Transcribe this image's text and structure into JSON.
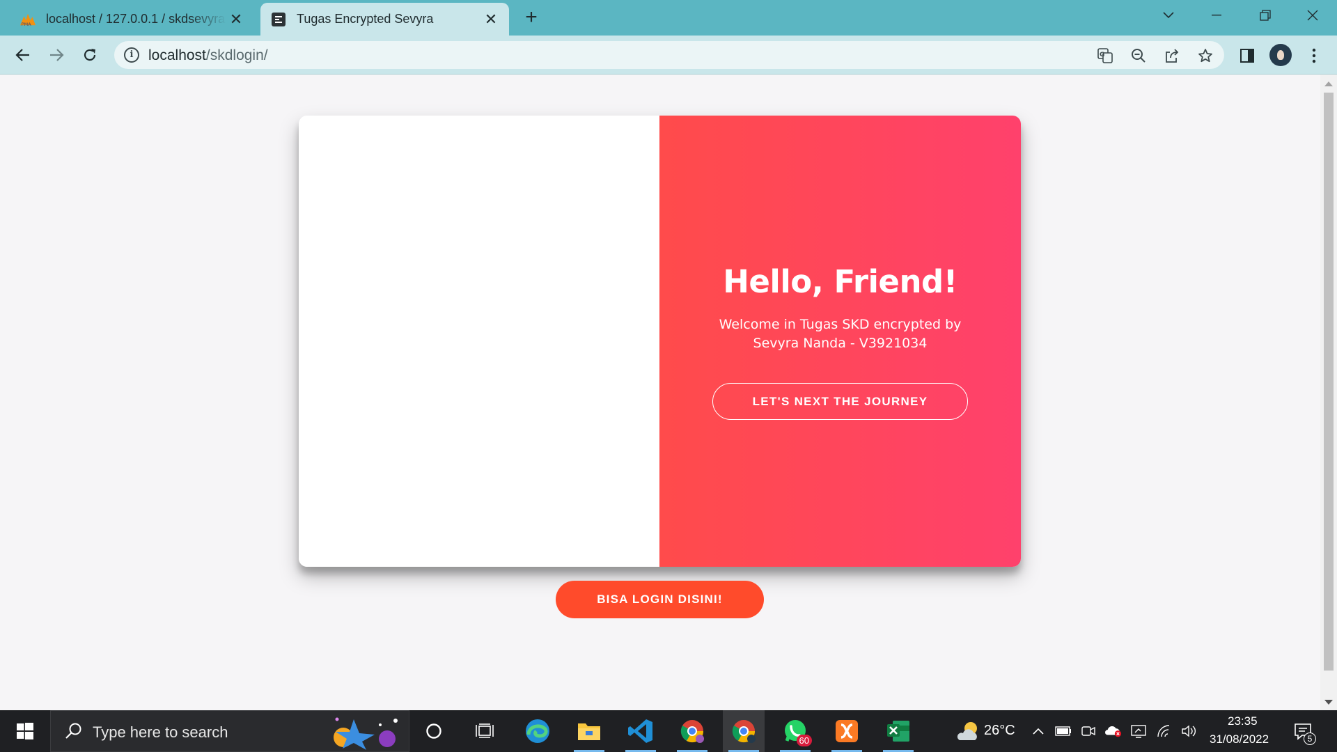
{
  "browser": {
    "tabs": [
      {
        "title": "localhost / 127.0.0.1 / skdsevyra / ",
        "favicon": "phpmyadmin-icon",
        "active": false
      },
      {
        "title": "Tugas Encrypted Sevyra",
        "favicon": "page-icon",
        "active": true
      }
    ],
    "address": {
      "host": "localhost",
      "path": "/skdlogin/"
    }
  },
  "page": {
    "overlay": {
      "heading": "Hello, Friend!",
      "text": "Welcome in Tugas SKD encrypted by Sevyra Nanda - V3921034",
      "button": "LET'S NEXT THE JOURNEY"
    },
    "login_button": "BISA LOGIN DISINI!",
    "colors": {
      "gradient_start": "#ff4b4b",
      "gradient_end": "#ff416c",
      "cta": "#ff4b2b"
    }
  },
  "taskbar": {
    "search_placeholder": "Type here to search",
    "apps": [
      "cortana-icon",
      "task-view-icon",
      "edge-icon",
      "file-explorer-icon",
      "vscode-icon",
      "chrome-profile-icon",
      "chrome-icon",
      "whatsapp-icon",
      "xampp-icon",
      "excel-icon"
    ],
    "whatsapp_badge": "60",
    "weather": "26°C",
    "time": "23:35",
    "date": "31/08/2022",
    "notifications": "5"
  }
}
